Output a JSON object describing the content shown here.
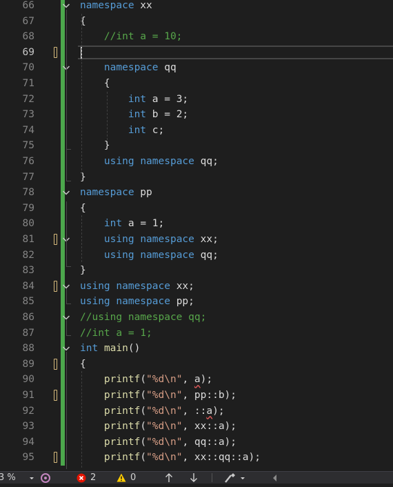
{
  "editor": {
    "lines": [
      {
        "num": "66",
        "tokens": [
          {
            "t": "namespace",
            "c": "kw"
          },
          {
            "t": " xx"
          }
        ]
      },
      {
        "num": "67",
        "tokens": [
          {
            "t": "{"
          }
        ]
      },
      {
        "num": "68",
        "tokens": [
          {
            "t": "    "
          },
          {
            "t": "//int a = 10;",
            "c": "cm"
          }
        ]
      },
      {
        "num": "69",
        "tokens": [],
        "current": true
      },
      {
        "num": "70",
        "tokens": [
          {
            "t": "    "
          },
          {
            "t": "namespace",
            "c": "kw"
          },
          {
            "t": " qq"
          }
        ]
      },
      {
        "num": "71",
        "tokens": [
          {
            "t": "    {"
          }
        ]
      },
      {
        "num": "72",
        "tokens": [
          {
            "t": "        "
          },
          {
            "t": "int",
            "c": "kw"
          },
          {
            "t": " a = 3;"
          }
        ]
      },
      {
        "num": "73",
        "tokens": [
          {
            "t": "        "
          },
          {
            "t": "int",
            "c": "kw"
          },
          {
            "t": " b = 2;"
          }
        ]
      },
      {
        "num": "74",
        "tokens": [
          {
            "t": "        "
          },
          {
            "t": "int",
            "c": "kw"
          },
          {
            "t": " c;"
          }
        ]
      },
      {
        "num": "75",
        "tokens": [
          {
            "t": "    }"
          }
        ]
      },
      {
        "num": "76",
        "tokens": [
          {
            "t": "    "
          },
          {
            "t": "using",
            "c": "kw"
          },
          {
            "t": " "
          },
          {
            "t": "namespace",
            "c": "kw"
          },
          {
            "t": " qq;"
          }
        ]
      },
      {
        "num": "77",
        "tokens": [
          {
            "t": "}"
          }
        ]
      },
      {
        "num": "78",
        "tokens": [
          {
            "t": "namespace",
            "c": "kw"
          },
          {
            "t": " pp"
          }
        ]
      },
      {
        "num": "79",
        "tokens": [
          {
            "t": "{"
          }
        ]
      },
      {
        "num": "80",
        "tokens": [
          {
            "t": "    "
          },
          {
            "t": "int",
            "c": "kw"
          },
          {
            "t": " a = 1;"
          }
        ]
      },
      {
        "num": "81",
        "tokens": [
          {
            "t": "    "
          },
          {
            "t": "using",
            "c": "kw"
          },
          {
            "t": " "
          },
          {
            "t": "namespace",
            "c": "kw"
          },
          {
            "t": " xx;"
          }
        ]
      },
      {
        "num": "82",
        "tokens": [
          {
            "t": "    "
          },
          {
            "t": "using",
            "c": "kw"
          },
          {
            "t": " "
          },
          {
            "t": "namespace",
            "c": "kw"
          },
          {
            "t": " qq;"
          }
        ]
      },
      {
        "num": "83",
        "tokens": [
          {
            "t": "}"
          }
        ]
      },
      {
        "num": "84",
        "tokens": [
          {
            "t": "using",
            "c": "kw"
          },
          {
            "t": " "
          },
          {
            "t": "namespace",
            "c": "kw"
          },
          {
            "t": " xx;"
          }
        ]
      },
      {
        "num": "85",
        "tokens": [
          {
            "t": "using",
            "c": "kw"
          },
          {
            "t": " "
          },
          {
            "t": "namespace",
            "c": "kw"
          },
          {
            "t": " pp;"
          }
        ]
      },
      {
        "num": "86",
        "tokens": [
          {
            "t": "//using namespace qq;",
            "c": "cm"
          }
        ]
      },
      {
        "num": "87",
        "tokens": [
          {
            "t": "//int a = 1;",
            "c": "cm"
          }
        ]
      },
      {
        "num": "88",
        "tokens": [
          {
            "t": "int",
            "c": "kw"
          },
          {
            "t": " "
          },
          {
            "t": "main",
            "c": "fn"
          },
          {
            "t": "()"
          }
        ]
      },
      {
        "num": "89",
        "tokens": [
          {
            "t": "{"
          }
        ]
      },
      {
        "num": "90",
        "tokens": [
          {
            "t": "    "
          },
          {
            "t": "printf",
            "c": "fn"
          },
          {
            "t": "("
          },
          {
            "t": "\"%d\\n\"",
            "c": "str"
          },
          {
            "t": ", "
          },
          {
            "t": "a",
            "sq": true
          },
          {
            "t": ");"
          }
        ]
      },
      {
        "num": "91",
        "tokens": [
          {
            "t": "    "
          },
          {
            "t": "printf",
            "c": "fn"
          },
          {
            "t": "("
          },
          {
            "t": "\"%d\\n\"",
            "c": "str"
          },
          {
            "t": ", pp::b);"
          }
        ]
      },
      {
        "num": "92",
        "tokens": [
          {
            "t": "    "
          },
          {
            "t": "printf",
            "c": "fn"
          },
          {
            "t": "("
          },
          {
            "t": "\"%d\\n\"",
            "c": "str"
          },
          {
            "t": ", ::"
          },
          {
            "t": "a",
            "sq": true
          },
          {
            "t": ");"
          }
        ]
      },
      {
        "num": "93",
        "tokens": [
          {
            "t": "    "
          },
          {
            "t": "printf",
            "c": "fn"
          },
          {
            "t": "("
          },
          {
            "t": "\"%d\\n\"",
            "c": "str"
          },
          {
            "t": ", xx::a);"
          }
        ]
      },
      {
        "num": "94",
        "tokens": [
          {
            "t": "    "
          },
          {
            "t": "printf",
            "c": "fn"
          },
          {
            "t": "("
          },
          {
            "t": "\"%d\\n\"",
            "c": "str"
          },
          {
            "t": ", qq::a);"
          }
        ]
      },
      {
        "num": "95",
        "tokens": [
          {
            "t": "    "
          },
          {
            "t": "printf",
            "c": "fn"
          },
          {
            "t": "("
          },
          {
            "t": "\"%d\\n\"",
            "c": "str"
          },
          {
            "t": ", xx::qq::a);"
          }
        ]
      }
    ],
    "folds": [
      "66",
      "70",
      "78",
      "81",
      "84",
      "86",
      "88"
    ],
    "modified_lines": [
      "69",
      "81",
      "84",
      "89",
      "91",
      "95"
    ]
  },
  "statusbar": {
    "zoom": "3 %",
    "errors": "2",
    "warnings": "0",
    "colors": {
      "error": "#e51400",
      "warning": "#ffcc00"
    }
  },
  "colors": {
    "background": "#1e1e1e",
    "keyword": "#569cd6",
    "comment": "#57a64a",
    "string": "#d69d85",
    "function": "#dcdcaa",
    "line_number": "#858585",
    "change_bar": "#4ca74c"
  }
}
